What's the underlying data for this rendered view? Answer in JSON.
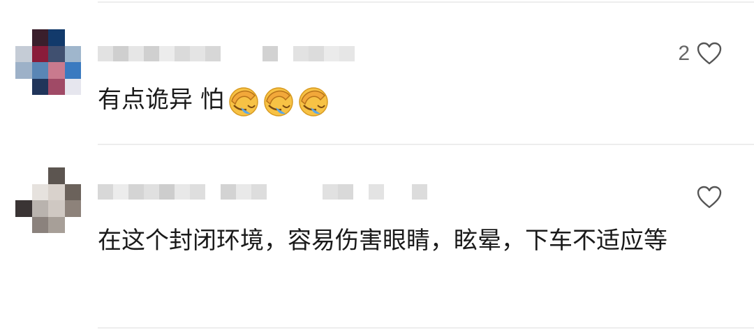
{
  "comments": [
    {
      "username": "",
      "text": "有点诡异 怕",
      "emojis": [
        "facepalm-icon",
        "facepalm-icon",
        "facepalm-icon"
      ],
      "like_count": "2",
      "like_icon": "heart-outline-icon"
    },
    {
      "username": "",
      "text": "在这个封闭环境，容易伤害眼睛，眩晕，下车不适应等",
      "emojis": [],
      "like_count": "",
      "like_icon": "heart-outline-icon"
    }
  ],
  "colors": {
    "text": "#1a1a1a",
    "like_count": "#666666",
    "divider": "#ededed",
    "emoji_face": "#f7c245",
    "emoji_hand": "#f2a83a",
    "emoji_tear": "#5aa6e8"
  }
}
